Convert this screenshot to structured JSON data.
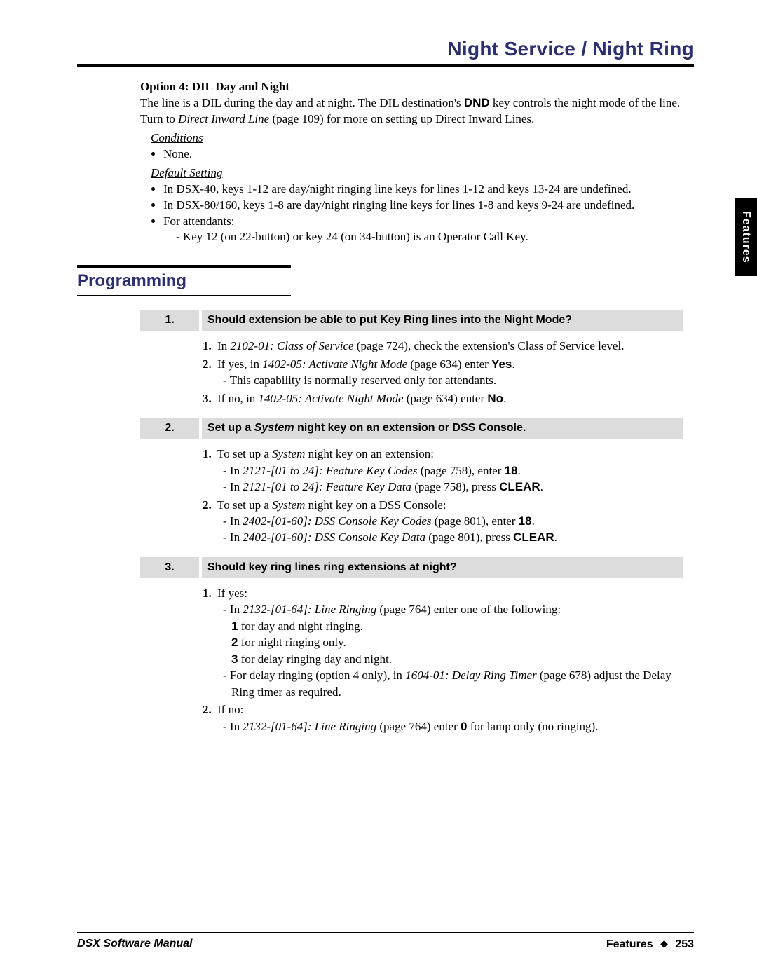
{
  "header": {
    "title": "Night Service / Night Ring"
  },
  "side_tab": "Features",
  "option4": {
    "heading": "Option 4: DIL Day and Night",
    "line1a": "The line is a DIL during the day and at night. The DIL destination's ",
    "dnd": "DND",
    "line1b": " key controls the night mode of the line. Turn to ",
    "dil_ref": "Direct Inward Line",
    "line1c": " (page 109) for more on setting up Direct Inward Lines.",
    "conditions_label": "Conditions",
    "cond_none": "None.",
    "default_label": "Default Setting",
    "d1": "In DSX-40, keys 1-12 are day/night ringing line keys for lines 1-12 and keys 13-24 are undefined.",
    "d2": "In DSX-80/160, keys 1-8 are day/night ringing line keys for lines 1-8 and keys 9-24 are undefined.",
    "d3": "For attendants:",
    "d3a": "- Key 12 (on 22-button) or key 24 (on 34-button) is an Operator Call Key."
  },
  "programming": {
    "title": "Programming"
  },
  "steps": [
    {
      "num": "1.",
      "title": "Should extension be able to put Key Ring lines into the Night Mode?",
      "items": {
        "i1a": "In ",
        "i1ref": "2102-01: Class of Service",
        "i1b": " (page 724), check the extension's Class of Service level.",
        "i2a": "If yes, in ",
        "i2ref": "1402-05: Activate Night Mode",
        "i2b": " (page 634) enter ",
        "i2c": "Yes",
        "i2d": ".",
        "i2sub": "This capability is normally reserved only for attendants.",
        "i3a": "If no, in ",
        "i3ref": "1402-05: Activate Night Mode",
        "i3b": " (page 634) enter ",
        "i3c": "No",
        "i3d": "."
      }
    },
    {
      "num": "2.",
      "title_a": "Set up a ",
      "title_i": "System",
      "title_b": " night key on an extension or DSS Console.",
      "items": {
        "i1a": "To set up a ",
        "i1i": "System",
        "i1b": " night key on an extension:",
        "s1a": "In ",
        "s1ref": "2121-[01 to 24]: Feature Key Codes",
        "s1b": " (page 758), enter ",
        "s1c": "18",
        "s1d": ".",
        "s2a": "In ",
        "s2ref": "2121-[01 to 24]: Feature Key Data",
        "s2b": " (page 758), press ",
        "s2c": "CLEAR",
        "s2d": ".",
        "i2a": "To set up a ",
        "i2i": "System",
        "i2b": " night key on a DSS Console:",
        "s3a": "In ",
        "s3ref": "2402-[01-60]: DSS Console Key Codes",
        "s3b": " (page 801), enter ",
        "s3c": "18",
        "s3d": ".",
        "s4a": "In ",
        "s4ref": "2402-[01-60]: DSS Console Key Data",
        "s4b": " (page 801), press ",
        "s4c": "CLEAR",
        "s4d": "."
      }
    },
    {
      "num": "3.",
      "title": "Should key ring lines ring extensions at night?",
      "items": {
        "i1": "If yes:",
        "s1a": "In ",
        "s1ref": "2132-[01-64]: Line Ringing",
        "s1b": " (page 764) enter one of the following:",
        "o1a": "1",
        "o1b": " for day and night ringing.",
        "o2a": "2",
        "o2b": " for night ringing only.",
        "o3a": "3",
        "o3b": " for delay ringing day and night.",
        "s2a": "For delay ringing (option 4 only), in ",
        "s2ref": "1604-01: Delay Ring Timer",
        "s2b": " (page 678) adjust the Delay Ring timer as required.",
        "i2": "If no:",
        "s3a": "In ",
        "s3ref": "2132-[01-64]: Line Ringing",
        "s3b": " (page 764) enter ",
        "s3c": "0",
        "s3d": " for lamp only (no ringing)."
      }
    }
  ],
  "footer": {
    "left": "DSX Software Manual",
    "right_label": "Features",
    "page": "253"
  }
}
